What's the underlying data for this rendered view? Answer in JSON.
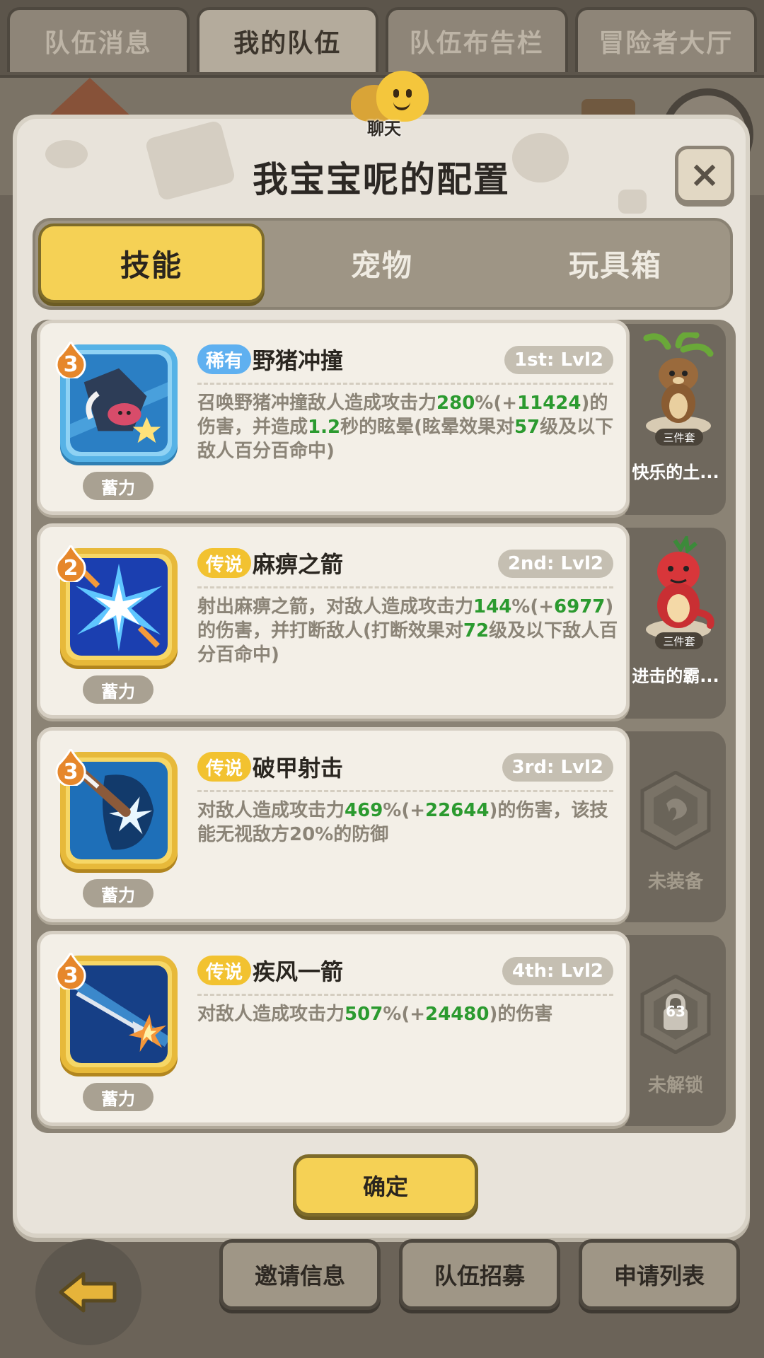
{
  "top_tabs": [
    "队伍消息",
    "我的队伍",
    "队伍布告栏",
    "冒险者大厅"
  ],
  "chat_label": "聊天",
  "modal": {
    "title": "我宝宝呢的配置",
    "close_symbol": "×",
    "tabs": [
      "技能",
      "宠物",
      "玩具箱"
    ],
    "active_tab": "技能",
    "confirm_label": "确定"
  },
  "skills": [
    {
      "level": "3",
      "rarity": "稀有",
      "rarity_type": "rare",
      "name": "野猪冲撞",
      "slot": "1st: Lvl2",
      "charge": "蓄力",
      "icon": "boar-charge-icon",
      "desc_parts": [
        "召唤野猪冲撞敌人造成攻击力",
        "280",
        "%(+",
        "11424",
        ")的伤害，并造成",
        "1.2",
        "秒的眩晕(眩晕效果对",
        "57",
        "级及以下敌人百分百命中)"
      ]
    },
    {
      "level": "2",
      "rarity": "传说",
      "rarity_type": "legend",
      "name": "麻痹之箭",
      "slot": "2nd: Lvl2",
      "charge": "蓄力",
      "icon": "paralysis-arrow-icon",
      "desc_parts": [
        "射出麻痹之箭，对敌人造成攻击力",
        "144",
        "%(+",
        "6977",
        ")的伤害，并打断敌人(打断效果对",
        "72",
        "级及以下敌人百分百命中)"
      ]
    },
    {
      "level": "3",
      "rarity": "传说",
      "rarity_type": "legend",
      "name": "破甲射击",
      "slot": "3rd: Lvl2",
      "charge": "蓄力",
      "icon": "armor-pierce-icon",
      "desc_parts": [
        "对敌人造成攻击力",
        "469",
        "%(+",
        "22644",
        ")的伤害，该技能无视敌方20%的防御"
      ]
    },
    {
      "level": "3",
      "rarity": "传说",
      "rarity_type": "legend",
      "name": "疾风一箭",
      "slot": "4th: Lvl2",
      "charge": "蓄力",
      "icon": "gale-arrow-icon",
      "desc_parts": [
        "对敌人造成攻击力",
        "507",
        "%(+",
        "24480",
        ")的伤害"
      ]
    }
  ],
  "pets": [
    {
      "name": "快乐的土...",
      "set_tag": "三件套",
      "icon": "tree-squirrel-pet-icon"
    },
    {
      "name": "进击的霸...",
      "set_tag": "三件套",
      "icon": "red-dino-pet-icon"
    },
    {
      "status": "未装备",
      "icon": "empty-slot-icon"
    },
    {
      "status": "未解锁",
      "lock_level": "63",
      "icon": "lock-icon"
    }
  ],
  "bottom_buttons": [
    "邀请信息",
    "队伍招募",
    "申请列表"
  ],
  "colors": {
    "accent_yellow": "#f5d155",
    "highlight_green": "#2b9a2f",
    "rare_blue": "#5fb0f0",
    "legend_gold": "#f2c230"
  }
}
